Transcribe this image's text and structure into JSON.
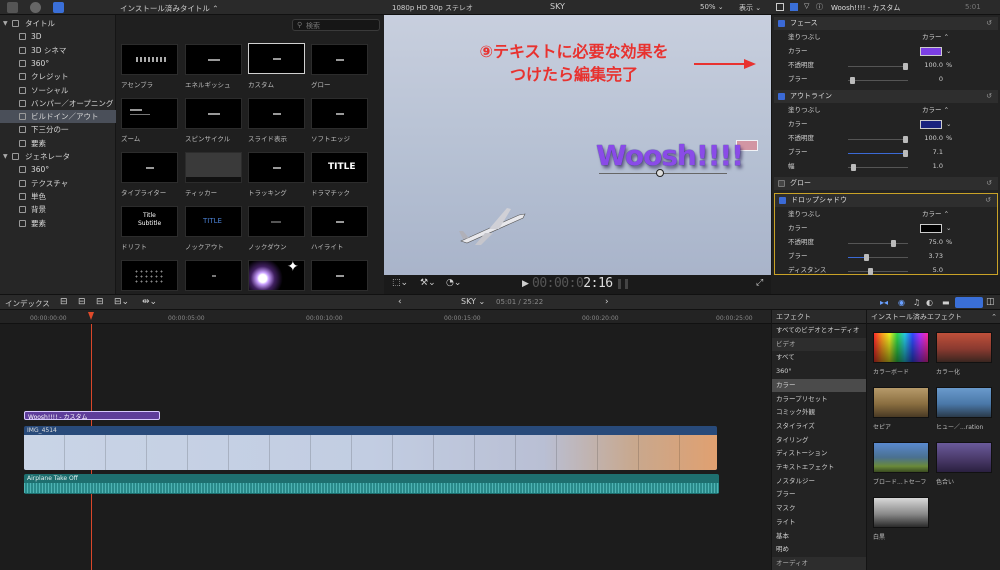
{
  "browser": {
    "header_title": "インストール済みタイトル",
    "search_placeholder": "検索",
    "titles": [
      "アセンブラ",
      "エネルギッシュ",
      "カスタム",
      "グロー",
      "ズーム",
      "スピンサイクル",
      "スライド表示",
      "ソフトエッジ",
      "タイプライター",
      "ティッカー",
      "トラッキング",
      "ドラマチック",
      "ドリフト",
      "ノックアウト",
      "ノックダウン",
      "ハイライト"
    ],
    "thumb_texts": {
      "dramatic": "TITLE",
      "drift_1": "Title",
      "drift_2": "Subtitle",
      "knockout": "TITLE"
    }
  },
  "sidebar": {
    "items": [
      {
        "label": "タイトル",
        "type": "group"
      },
      {
        "label": "3D"
      },
      {
        "label": "3D シネマ"
      },
      {
        "label": "360°"
      },
      {
        "label": "クレジット"
      },
      {
        "label": "ソーシャル"
      },
      {
        "label": "バンパー／オープニング"
      },
      {
        "label": "ビルドイン／アウト",
        "selected": true
      },
      {
        "label": "下三分の一"
      },
      {
        "label": "要素"
      },
      {
        "label": "ジェネレータ",
        "type": "group"
      },
      {
        "label": "360°"
      },
      {
        "label": "テクスチャ"
      },
      {
        "label": "単色"
      },
      {
        "label": "背景"
      },
      {
        "label": "要素"
      }
    ]
  },
  "viewer": {
    "format": "1080p HD 30p ステレオ",
    "project": "SKY",
    "zoom": "50%",
    "display_menu": "表示",
    "annotation_line1": "⑨テキストに必要な効果を",
    "annotation_line2": "つけたら編集完了",
    "title_text": "Woosh!!!!",
    "timecode_dim": "00:00:0",
    "timecode_bright": "2:16"
  },
  "inspector": {
    "clip_title": "Woosh!!!! - カスタム",
    "timecode": "5:01",
    "sections": {
      "face": "フェース",
      "outline": "アウトライン",
      "glow": "グロー",
      "drop_shadow": "ドロップシャドウ"
    },
    "labels": {
      "fill": "塗りつぶし",
      "color": "カラー",
      "opacity": "不透明度",
      "blur": "ブラー",
      "width": "幅",
      "distance": "ディスタンス",
      "fill_value": "カラー"
    },
    "face": {
      "opacity": "100.0",
      "blur": "0",
      "color": "#7b3fe4"
    },
    "outline": {
      "opacity": "100.0",
      "blur": "7.1",
      "width": "1.0",
      "color": "#1a237e"
    },
    "drop_shadow": {
      "opacity": "75.0",
      "blur": "3.73",
      "distance": "5.0",
      "color": "#000000"
    },
    "percent": "%"
  },
  "timeline": {
    "index_label": "インデックス",
    "project": "SKY",
    "position": "05:01 / 25:22",
    "ruler": [
      "00:00:00:00",
      "00:00:05:00",
      "00:00:10:00",
      "00:00:15:00",
      "00:00:20:00",
      "00:00:25:00"
    ],
    "title_clip": "Woosh!!!! - カスタム",
    "video_clip": "IMG_4514",
    "audio_clip": "Airplane Take Off"
  },
  "effects": {
    "header": "エフェクト",
    "installed_header": "インストール済みエフェクト",
    "categories": [
      {
        "label": "すべてのビデオとオーディオ"
      },
      {
        "label": "ビデオ",
        "type": "header"
      },
      {
        "label": "すべて"
      },
      {
        "label": "360°"
      },
      {
        "label": "カラー",
        "selected": true
      },
      {
        "label": "カラープリセット"
      },
      {
        "label": "コミック外観"
      },
      {
        "label": "スタイライズ"
      },
      {
        "label": "タイリング"
      },
      {
        "label": "ディストーション"
      },
      {
        "label": "テキストエフェクト"
      },
      {
        "label": "ノスタルジー"
      },
      {
        "label": "ブラー"
      },
      {
        "label": "マスク"
      },
      {
        "label": "ライト"
      },
      {
        "label": "基本"
      },
      {
        "label": "明め"
      },
      {
        "label": "オーディオ",
        "type": "header"
      }
    ],
    "thumbs": [
      "カラーボード",
      "カラー化",
      "セピア",
      "ヒュー／...ration",
      "ブロード...トセーフ",
      "色合い",
      "白黒"
    ]
  }
}
